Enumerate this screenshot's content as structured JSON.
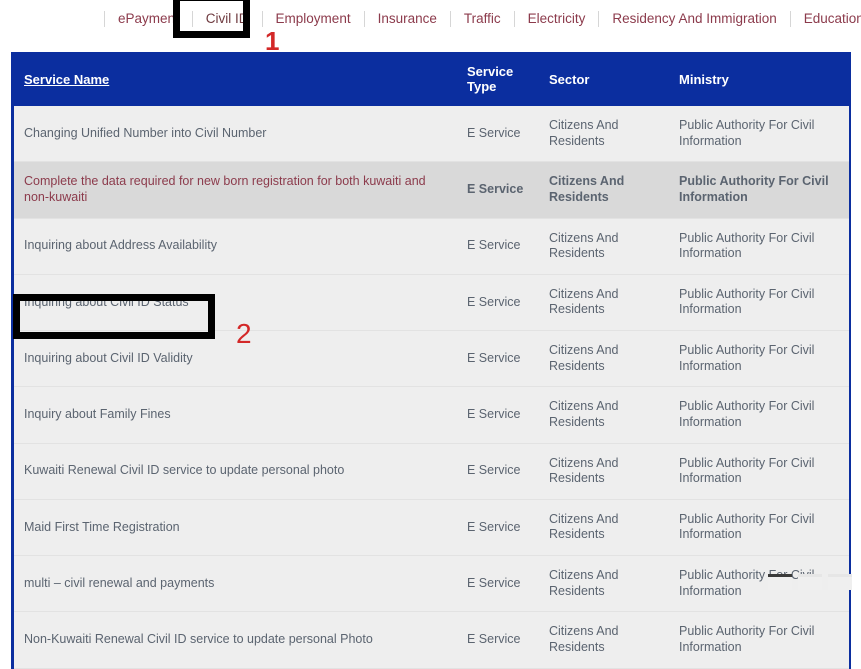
{
  "nav": {
    "items": [
      {
        "label": "ePayment",
        "active": false
      },
      {
        "label": "Civil ID",
        "active": true
      },
      {
        "label": "Employment",
        "active": false
      },
      {
        "label": "Insurance",
        "active": false
      },
      {
        "label": "Traffic",
        "active": false
      },
      {
        "label": "Electricity",
        "active": false
      },
      {
        "label": "Residency And Immigration",
        "active": false
      },
      {
        "label": "Education",
        "active": false
      }
    ]
  },
  "table": {
    "headers": {
      "service_name": "Service Name",
      "service_type": "Service Type",
      "sector": "Sector",
      "ministry": "Ministry"
    },
    "rows": [
      {
        "name": "Changing Unified Number into Civil Number",
        "type": "E Service",
        "sector": "Citizens And Residents",
        "ministry": "Public Authority For Civil Information",
        "hovered": false
      },
      {
        "name": "Complete the data required for new born registration for both kuwaiti and non-kuwaiti",
        "type": "E Service",
        "sector": "Citizens And Residents",
        "ministry": "Public Authority For Civil Information",
        "hovered": true
      },
      {
        "name": "Inquiring about Address Availability",
        "type": "E Service",
        "sector": "Citizens And Residents",
        "ministry": "Public Authority For Civil Information",
        "hovered": false
      },
      {
        "name": "Inquiring about Civil ID Status",
        "type": "E Service",
        "sector": "Citizens And Residents",
        "ministry": "Public Authority For Civil Information",
        "hovered": false
      },
      {
        "name": "Inquiring about Civil ID Validity",
        "type": "E Service",
        "sector": "Citizens And Residents",
        "ministry": "Public Authority For Civil Information",
        "hovered": false
      },
      {
        "name": "Inquiry about Family Fines",
        "type": "E Service",
        "sector": "Citizens And Residents",
        "ministry": "Public Authority For Civil Information",
        "hovered": false
      },
      {
        "name": "Kuwaiti Renewal Civil ID service to update personal photo",
        "type": "E Service",
        "sector": "Citizens And Residents",
        "ministry": "Public Authority For Civil Information",
        "hovered": false
      },
      {
        "name": "Maid First Time Registration",
        "type": "E Service",
        "sector": "Citizens And Residents",
        "ministry": "Public Authority For Civil Information",
        "hovered": false
      },
      {
        "name": "multi – civil renewal and payments",
        "type": "E Service",
        "sector": "Citizens And Residents",
        "ministry": "Public Authority For Civil Information",
        "hovered": false
      },
      {
        "name": "Non-Kuwaiti Renewal Civil ID service to update personal Photo",
        "type": "E Service",
        "sector": "Citizens And Residents",
        "ministry": "Public Authority For Civil Information",
        "hovered": false
      }
    ]
  },
  "annotations": [
    {
      "number": "1",
      "target": "Civil ID"
    },
    {
      "number": "2",
      "target": "Inquiring about Civil ID Validity"
    }
  ],
  "colors": {
    "header_blue": "#0b2e9f",
    "link_maroon": "#8c3b4c",
    "row_bg": "#eeeeee",
    "row_hover_bg": "#d9d9d9",
    "annotation_red": "#d32828",
    "annotation_box": "#000000"
  }
}
